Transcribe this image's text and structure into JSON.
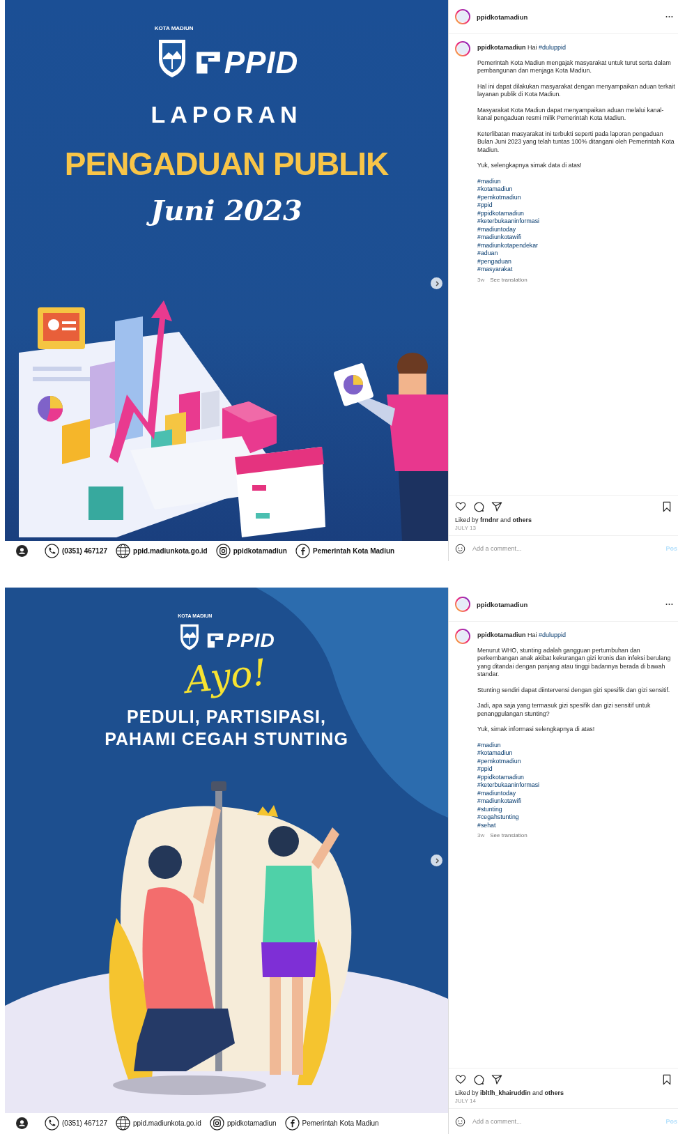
{
  "posts": [
    {
      "poster": {
        "kind": "report",
        "org_label": "KOTA MADIUN",
        "logo_text": "PPID",
        "texts": [
          {
            "kind": "title",
            "text": "LAPORAN"
          },
          {
            "kind": "headline",
            "text": "PENGADUAN PUBLIK"
          },
          {
            "kind": "subtitle",
            "text": "Juni 2023"
          }
        ]
      },
      "contacts": [
        {
          "kind": "phone",
          "text": "(0351) 467127"
        },
        {
          "kind": "web",
          "text": "ppid.madiunkota.go.id"
        },
        {
          "kind": "instagram",
          "text": "ppidkotamadiun"
        },
        {
          "kind": "facebook",
          "text": "Pemerintah Kota Madiun"
        }
      ],
      "author": "ppidkotamadiun",
      "caption": {
        "lead": "**ppidkotamadiun** Hai",
        "tag": "#duluppid",
        "paragraphs": [
          "Pemerintah Kota Madiun mengajak masyarakat untuk turut serta dalam pembangunan dan menjaga Kota Madiun.",
          "Hal ini dapat dilakukan masyarakat dengan menyampaikan aduan terkait layanan publik di Kota Madiun.",
          "Masyarakat Kota Madiun dapat menyampaikan aduan melalui kanal-kanal pengaduan resmi milik Pemerintah Kota Madiun.",
          "Keterlibatan masyarakat ini terbukti seperti pada laporan pengaduan Bulan Juni 2023 yang telah tuntas 100% ditangani oleh Pemerintah Kota Madiun.",
          "Yuk, selengkapnya simak data di atas!"
        ],
        "hashtags": [
          "#madiun",
          "#kotamadiun",
          "#pemkotmadiun",
          "#ppid",
          "#ppidkotamadiun",
          "#keterbukaaninformasi",
          "#madiuntoday",
          "#madiunkotawifi",
          "#madiunkotapendekar",
          "#aduan",
          "#pengaduan",
          "#masyarakat"
        ],
        "age": "3w",
        "translate": "See translation"
      },
      "liked_by": "Liked by **frndnr** and **others**",
      "date": "JULY 13",
      "comment_placeholder": "Add a comment...",
      "post_button": "Pos"
    },
    {
      "poster": {
        "kind": "campaign",
        "org_label": "KOTA MADIUN",
        "logo_text": "PPID",
        "texts": [
          {
            "kind": "exclaim",
            "text": "Ayo!"
          },
          {
            "kind": "banner",
            "text": "PEDULI, PARTISIPASI,"
          },
          {
            "kind": "banner",
            "text": "PAHAMI CEGAH STUNTING"
          }
        ]
      },
      "contacts": [
        {
          "kind": "phone",
          "text": "(0351) 467127"
        },
        {
          "kind": "web",
          "text": "ppid.madiunkota.go.id"
        },
        {
          "kind": "instagram",
          "text": "ppidkotamadiun"
        },
        {
          "kind": "facebook",
          "text": "Pemerintah Kota Madiun"
        }
      ],
      "author": "ppidkotamadiun",
      "caption": {
        "lead": "**ppidkotamadiun** Hai",
        "tag": "#duluppid",
        "paragraphs": [
          "Menurut WHO, stunting adalah gangguan pertumbuhan dan perkembangan anak akibat kekurangan gizi kronis dan infeksi berulang yang ditandai dengan panjang atau tinggi badannya berada di bawah standar.",
          "Stunting sendiri dapat diintervensi dengan gizi spesifik dan gizi sensitif.",
          "Jadi, apa saja yang termasuk gizi spesifik dan gizi sensitif untuk penanggulangan stunting?",
          "Yuk, simak informasi selengkapnya di atas!"
        ],
        "hashtags": [
          "#madiun",
          "#kotamadiun",
          "#pemkotmadiun",
          "#ppid",
          "#ppidkotamadiun",
          "#keterbukaaninformasi",
          "#madiuntoday",
          "#madiunkotawifi",
          "#stunting",
          "#cegahstunting",
          "#sehat"
        ],
        "age": "3w",
        "translate": "See translation"
      },
      "liked_by": "Liked by **ibltlh_khairuddin** and **others**",
      "date": "JULY 14",
      "comment_placeholder": "Add a comment...",
      "post_button": "Pos"
    }
  ]
}
